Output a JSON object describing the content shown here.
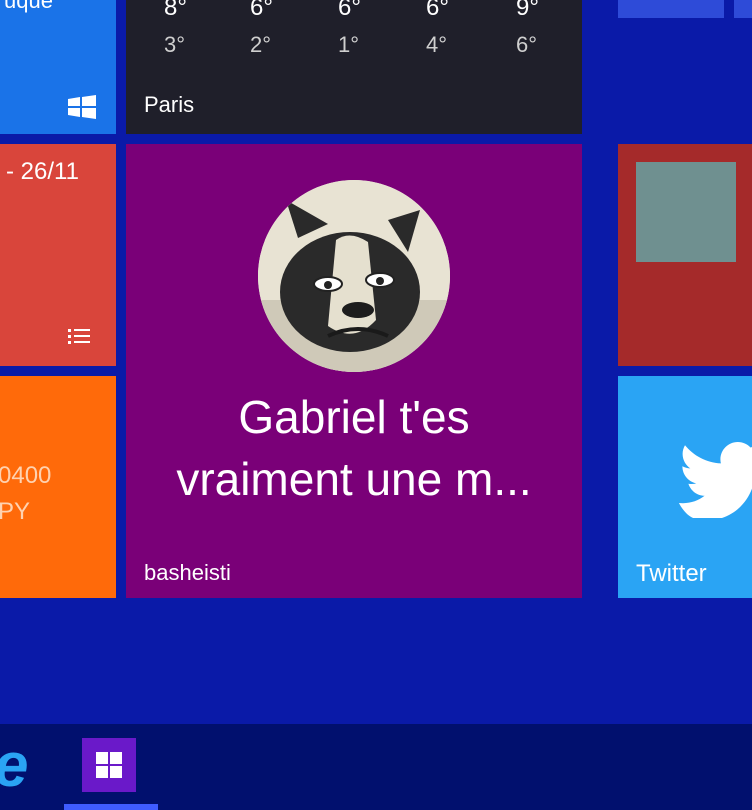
{
  "tiles": {
    "store": {
      "partial_text": "uque",
      "icon": "windows-logo-icon"
    },
    "weather": {
      "highs": [
        "8°",
        "6°",
        "6°",
        "6°",
        "9°"
      ],
      "lows": [
        "3°",
        "2°",
        "1°",
        "4°",
        "6°"
      ],
      "city": "Paris"
    },
    "calendar": {
      "date_partial": "- 26/11",
      "icon": "list-icon"
    },
    "orange": {
      "line1": "0400",
      "line2": "PY"
    },
    "people": {
      "message": "Gabriel t'es vraiment une m...",
      "message_line1": "Gabriel t'es",
      "message_line2": "vraiment une m...",
      "name": "basheisti",
      "avatar": "bulldog-avatar"
    },
    "twitter": {
      "label": "Twitter",
      "icon": "twitter-bird-icon"
    }
  },
  "taskbar": {
    "ie_glyph": "e",
    "start_icon": "tile-app-icon"
  },
  "colors": {
    "desktop": "#0a1aa8",
    "store": "#1a73e8",
    "weather": "#1f1f2a",
    "calendar": "#d9453b",
    "orange": "#ff6a0a",
    "people": "#7a0078",
    "red_right": "#a52a2a",
    "twitter": "#2aa4f4",
    "taskbar": "#01106e"
  }
}
